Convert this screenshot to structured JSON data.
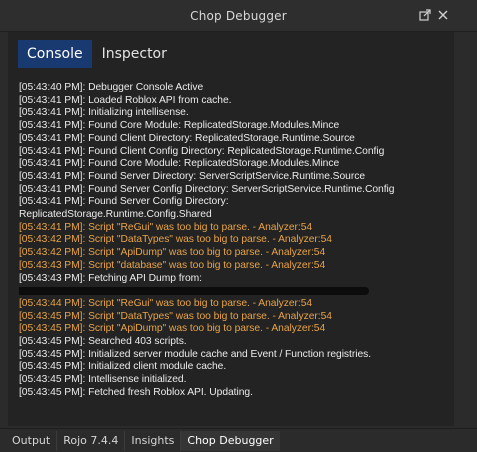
{
  "window": {
    "title": "Chop Debugger",
    "undock_icon": "undock-icon",
    "close_icon": "close-icon"
  },
  "tabs": [
    {
      "label": "Console",
      "active": true
    },
    {
      "label": "Inspector",
      "active": false
    }
  ],
  "console": {
    "lines": [
      {
        "text": "[05:43:40 PM]: Debugger Console Active",
        "type": "info"
      },
      {
        "text": "[05:43:41 PM]: Loaded Roblox API from cache.",
        "type": "info"
      },
      {
        "text": "[05:43:41 PM]: Initializing intellisense.",
        "type": "info"
      },
      {
        "text": "[05:43:41 PM]: Found Core Module: ReplicatedStorage.Modules.Mince",
        "type": "info"
      },
      {
        "text": "[05:43:41 PM]: Found Client Directory: ReplicatedStorage.Runtime.Source",
        "type": "info"
      },
      {
        "text": "[05:43:41 PM]: Found Client Config Directory: ReplicatedStorage.Runtime.Config",
        "type": "info"
      },
      {
        "text": "[05:43:41 PM]: Found Core Module: ReplicatedStorage.Modules.Mince",
        "type": "info"
      },
      {
        "text": "[05:43:41 PM]: Found Server Directory: ServerScriptService.Runtime.Source",
        "type": "info"
      },
      {
        "text": "[05:43:41 PM]: Found Server Config Directory: ServerScriptService.Runtime.Config",
        "type": "info"
      },
      {
        "text": "[05:43:41 PM]: Found Server Config Directory:",
        "type": "info"
      },
      {
        "text": "ReplicatedStorage.Runtime.Config.Shared",
        "type": "info"
      },
      {
        "text": "[05:43:41 PM]: Script \"ReGui\" was too big to parse. - Analyzer:54",
        "type": "warn"
      },
      {
        "text": "[05:43:42 PM]: Script \"DataTypes\" was too big to parse. - Analyzer:54",
        "type": "warn"
      },
      {
        "text": "[05:43:42 PM]: Script \"ApiDump\" was too big to parse. - Analyzer:54",
        "type": "warn"
      },
      {
        "text": "[05:43:43 PM]: Script \"database\" was too big to parse. - Analyzer:54",
        "type": "warn"
      },
      {
        "text": "[05:43:43 PM]: Fetching API Dump from:",
        "type": "info"
      },
      {
        "text": "",
        "type": "redacted"
      },
      {
        "text": "[05:43:44 PM]: Script \"ReGui\" was too big to parse. - Analyzer:54",
        "type": "warn"
      },
      {
        "text": "[05:43:45 PM]: Script \"DataTypes\" was too big to parse. - Analyzer:54",
        "type": "warn"
      },
      {
        "text": "[05:43:45 PM]: Script \"ApiDump\" was too big to parse. - Analyzer:54",
        "type": "warn"
      },
      {
        "text": "[05:43:45 PM]: Searched 403 scripts.",
        "type": "info"
      },
      {
        "text": "[05:43:45 PM]: Initialized server module cache and Event / Function registries.",
        "type": "info"
      },
      {
        "text": "[05:43:45 PM]: Initialized client module cache.",
        "type": "info"
      },
      {
        "text": "[05:43:45 PM]: Intellisense initialized.",
        "type": "info"
      },
      {
        "text": "[05:43:45 PM]: Fetched fresh Roblox API. Updating.",
        "type": "info"
      }
    ]
  },
  "bottom_tabs": [
    {
      "label": "Output",
      "active": false
    },
    {
      "label": "Rojo 7.4.4",
      "active": false
    },
    {
      "label": "Insights",
      "active": false
    },
    {
      "label": "Chop Debugger",
      "active": true
    }
  ],
  "colors": {
    "info": "#ebebeb",
    "warn": "#e8a347",
    "active_tab": "#193a70"
  }
}
